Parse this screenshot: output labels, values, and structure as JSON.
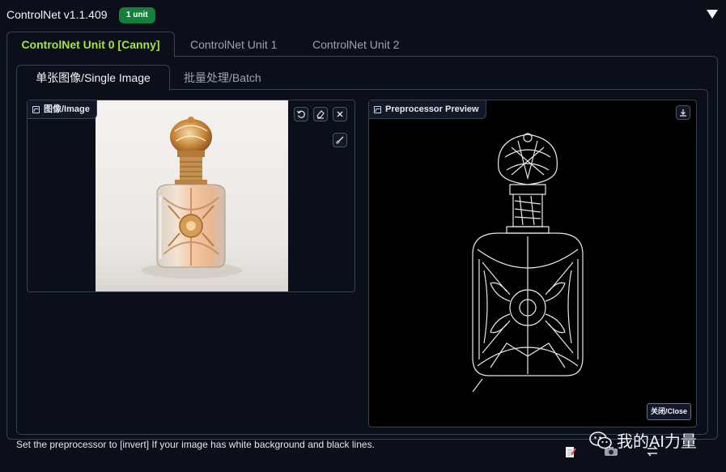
{
  "header": {
    "title": "ControlNet v1.1.409",
    "badge": "1 unit"
  },
  "unit_tabs": [
    {
      "label": "ControlNet Unit 0 [Canny]",
      "active": true
    },
    {
      "label": "ControlNet Unit 1",
      "active": false
    },
    {
      "label": "ControlNet Unit 2",
      "active": false
    }
  ],
  "mode_tabs": [
    {
      "label": "单张图像/Single Image",
      "active": true
    },
    {
      "label": "批量处理/Batch",
      "active": false
    }
  ],
  "image_input": {
    "label": "图像/Image"
  },
  "preview": {
    "label": "Preprocessor Preview",
    "close_label": "关闭/Close"
  },
  "hint_text": "Set the preprocessor to [invert] If your image has white background and black lines.",
  "watermark": "我的AI力量",
  "colors": {
    "background": "#0b0f19",
    "active_tab": "#a3e635",
    "badge": "#15803d"
  }
}
